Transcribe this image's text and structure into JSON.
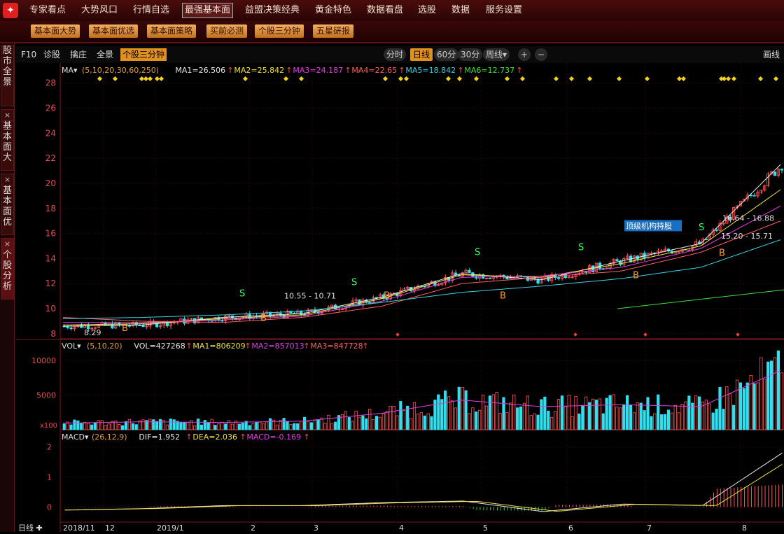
{
  "topnav": {
    "logo": "✦",
    "items": [
      "专家看点",
      "大势风口",
      "行情自选",
      "最强基本面",
      "益盟决策经典",
      "黄金特色",
      "数据看盘",
      "选股",
      "数据",
      "服务设置"
    ]
  },
  "subnav": {
    "buttons": [
      "基本面大势",
      "基本面优选",
      "基本面策略",
      "买前必测",
      "个股三分钟",
      "五星研报"
    ]
  },
  "leftbar": {
    "tabs": [
      "股市全景",
      "基本面大",
      "基本面优",
      "个股分析"
    ],
    "close_glyph": "×"
  },
  "toolbar": {
    "f10": "F10",
    "diagnose": "诊股",
    "catch": "擒庄",
    "panorama": "全景",
    "three_min": "个股三分钟",
    "periods": [
      "分时",
      "日线",
      "60分",
      "30分",
      "周线▾"
    ],
    "zoom_in": "+",
    "zoom_out": "−",
    "draw": "画线"
  },
  "ma_legend": {
    "head": "MA▾",
    "params": "(5,10,20,30,60,250)",
    "items": [
      {
        "text": "MA1=26.506",
        "color": "#e8e8e8"
      },
      {
        "text": "MA2=25.842",
        "color": "#f0e040"
      },
      {
        "text": "MA3=24.187",
        "color": "#e040e0"
      },
      {
        "text": "MA4=22.65",
        "color": "#ff6060"
      },
      {
        "text": "MA5=18.842",
        "color": "#40d0e0"
      },
      {
        "text": "MA6=12.737",
        "color": "#40e040"
      }
    ]
  },
  "vol_legend": {
    "head": "VOL▾",
    "params": "(5,10,20)",
    "items": [
      {
        "text": "VOL=427268",
        "color": "#e8e8e8"
      },
      {
        "text": "MA1=806209",
        "color": "#f0e040"
      },
      {
        "text": "MA2=857013",
        "color": "#e040e0"
      },
      {
        "text": "MA3=847728",
        "color": "#ff6060"
      }
    ],
    "unit": "x100"
  },
  "macd_legend": {
    "head": "MACD▾",
    "params": "(26,12,9)",
    "items": [
      {
        "text": "DIF=1.952",
        "color": "#e8e8e8"
      },
      {
        "text": "DEA=2.036",
        "color": "#f0e040"
      },
      {
        "text": "MACD=-0.169",
        "color": "#e040e0"
      }
    ]
  },
  "annotations": {
    "low_label": "8.29",
    "range1": "10.55 - 10.71",
    "range2": "16.64 - 16.88",
    "range3": "15.20 - 15.71",
    "inst_tag": "顶级机构持股",
    "buy": "B",
    "sell": "S"
  },
  "xaxis": {
    "period_label": "日线",
    "labels": [
      "2018/11",
      "12",
      "2019/1",
      "2",
      "3",
      "4",
      "5",
      "6",
      "7",
      "8"
    ]
  },
  "colors": {
    "up": "#ff5a5a",
    "down": "#30e0f0",
    "grid": "#3a0a0a",
    "accent": "#e09020"
  },
  "chart_data": {
    "type": "line",
    "title": "",
    "price_axis_ticks": [
      8,
      10,
      12,
      14,
      16,
      18,
      20,
      22,
      24,
      26,
      28
    ],
    "volume_axis_ticks": [
      5000,
      10000
    ],
    "macd_axis_ticks": [
      0,
      1,
      2
    ],
    "x_categories": [
      "2018/11",
      "12",
      "2019/1",
      "2",
      "3",
      "4",
      "5",
      "6",
      "7",
      "8"
    ],
    "series": [
      {
        "values": [
          8.6,
          8.7,
          9.3,
          9.6,
          10.9,
          12.8,
          12.3,
          13.8,
          15.2,
          21.5
        ]
      },
      {
        "values": [
          8.7,
          8.8,
          9.2,
          9.5,
          10.8,
          12.7,
          12.5,
          13.6,
          15.0,
          19.5
        ]
      },
      {
        "values": [
          8.9,
          8.9,
          9.1,
          9.4,
          10.6,
          12.5,
          12.6,
          13.3,
          14.8,
          18.2
        ]
      },
      {
        "values": [
          9.3,
          9.0,
          8.9,
          9.3,
          10.2,
          12.0,
          12.5,
          13.0,
          14.5,
          17.0
        ]
      },
      {
        "values": [
          9.2,
          9.3,
          9.5,
          9.8,
          10.5,
          11.3,
          11.8,
          12.4,
          13.3,
          15.5
        ]
      }
    ],
    "volume_values": [
      1000,
      1200,
      1100,
      1300,
      2500,
      4500,
      3500,
      3800,
      3500,
      9000
    ],
    "macd_dif": [
      -0.1,
      -0.05,
      0.05,
      0.05,
      0.15,
      0.2,
      -0.15,
      0.1,
      0.05,
      1.8
    ],
    "grid": true
  }
}
